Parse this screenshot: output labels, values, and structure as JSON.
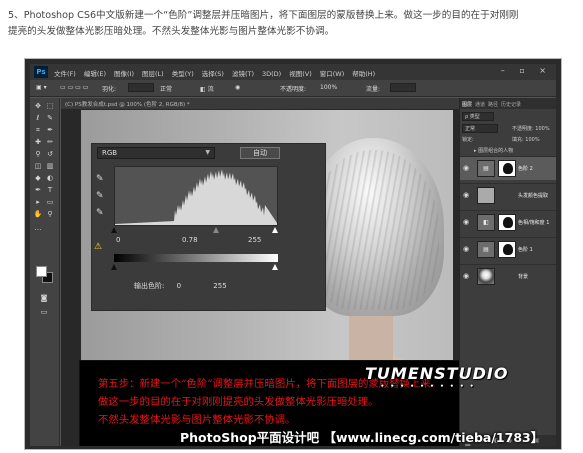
{
  "intro": {
    "line1": "5、Photoshop CS6中文版新建一个“色阶”调整层并压暗图片，将下面图层的蒙版替换上来。做这一步的目的在于对刚刚",
    "line2": "提亮的头发做整体光影压暗处理。不然头发整体光影与图片整体光影不协调。"
  },
  "app": {
    "logo": "Ps",
    "menu": [
      "文件(F)",
      "编辑(E)",
      "图像(I)",
      "图层(L)",
      "类型(Y)",
      "选择(S)",
      "滤镜(T)",
      "3D(D)",
      "视图(V)",
      "窗口(W)",
      "帮助(H)"
    ],
    "window_controls": "– ▫ ×"
  },
  "options_bar": {
    "feather_label": "羽化:",
    "style_label": "正常",
    "opacity_label": "不透明度:",
    "flow_label": "流量:",
    "opacity_value": "100%"
  },
  "document": {
    "tab_title": "(C) PS教发合成t.psd @ 100% (色阶 2, RGB/8) *"
  },
  "levels": {
    "channel": "RGB",
    "auto_button": "自动",
    "input_black": "0",
    "input_gamma": "0.78",
    "input_white": "255",
    "output_label": "输出色阶:",
    "output_black": "0",
    "output_white": "255"
  },
  "layers_panel": {
    "tabs": [
      "图层",
      "通道",
      "路径",
      "历史记录"
    ],
    "kind_filter": "ρ 类型",
    "blend_mode": "正常",
    "opacity_label": "不透明度: 100%",
    "lock_label": "锁定:",
    "fill_label": "填充: 100%",
    "group_name": "▸ 图层组合的人物",
    "layers": [
      {
        "name": "色阶 2",
        "selected": true,
        "has_mask": true,
        "thumb": "▤"
      },
      {
        "name": "头发颜色提取",
        "selected": false,
        "has_mask": false,
        "thumb": ""
      },
      {
        "name": "色相/饱和度 1",
        "selected": false,
        "has_mask": true,
        "thumb": "◧"
      },
      {
        "name": "色阶 1",
        "selected": false,
        "has_mask": true,
        "thumb": "▤"
      },
      {
        "name": "背景",
        "selected": false,
        "has_mask": false,
        "thumb": ""
      }
    ],
    "bottom_icons": "⚭ fx ◐ ◑ ▭ ▣ 🗑"
  },
  "caption": {
    "line1": "第五步：新建一个“色阶”调整层并压暗图片，将下面图层的蒙版替换上来。",
    "line2": "做这一步的目的在于对刚刚提亮的头发做整体光影压暗处理。",
    "line3": "不然头发整体光影与图片整体光影不协调。"
  },
  "logo_text": "TUMENSTUDIO",
  "watermark": "PhotoShop平面设计吧 【www.linecg.com/tieba/1783】"
}
